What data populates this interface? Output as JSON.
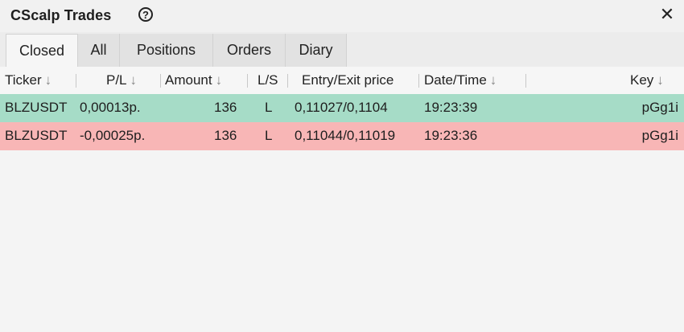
{
  "window": {
    "title": "CScalp Trades",
    "help_glyph": "?",
    "close_glyph": "✕"
  },
  "tabs": [
    {
      "label": "Closed",
      "active": true
    },
    {
      "label": "All"
    },
    {
      "label": "Positions"
    },
    {
      "label": "Orders"
    },
    {
      "label": "Diary"
    }
  ],
  "columns": {
    "ticker": "Ticker",
    "pl": "P/L",
    "amount": "Amount",
    "ls": "L/S",
    "price": "Entry/Exit price",
    "datetime": "Date/Time",
    "key": "Key",
    "sort_glyph": "↓"
  },
  "rows": [
    {
      "ticker": "BLZUSDT",
      "pl": "0,00013p.",
      "amount": "136",
      "ls": "L",
      "price": "0,11027/0,1104",
      "datetime": "19:23:39",
      "key": "pGg1i",
      "result": "profit"
    },
    {
      "ticker": "BLZUSDT",
      "pl": "-0,00025p.",
      "amount": "136",
      "ls": "L",
      "price": "0,11044/0,11019",
      "datetime": "19:23:36",
      "key": "pGg1i",
      "result": "loss"
    }
  ],
  "colors": {
    "profit_row": "#a6dcc7",
    "loss_row": "#f8b6b6",
    "background": "#f4f4f4"
  }
}
